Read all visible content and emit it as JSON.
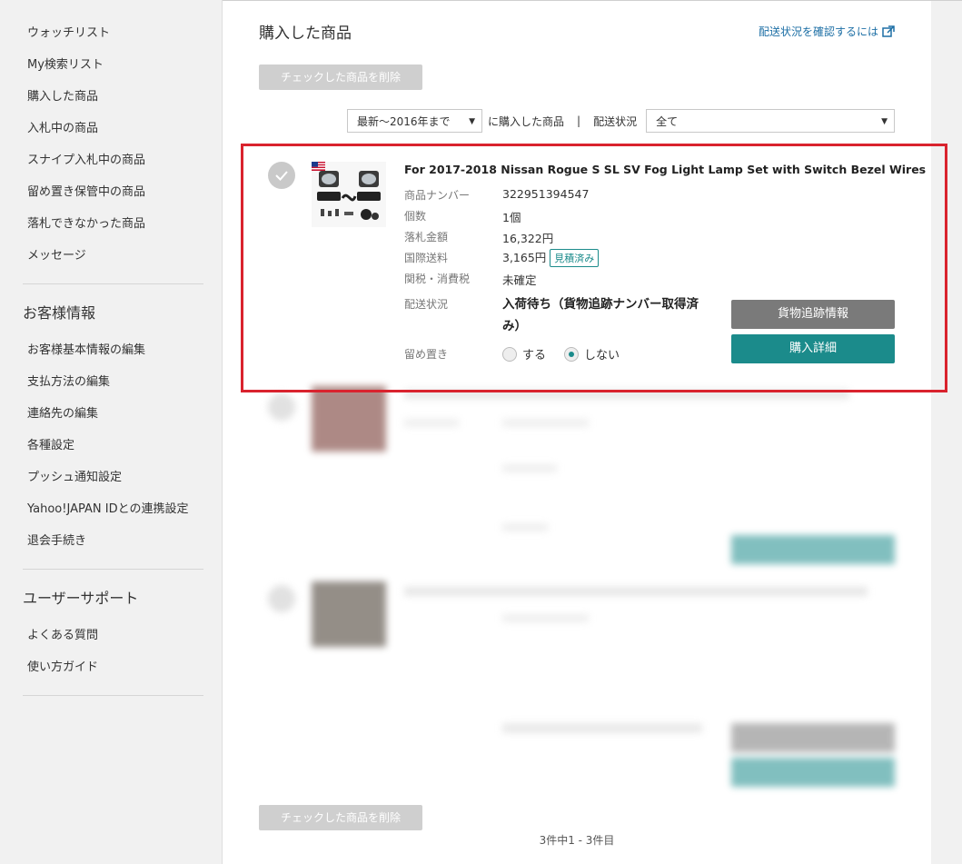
{
  "sidebar": {
    "menu1": [
      "ウォッチリスト",
      "My検索リスト",
      "購入した商品",
      "入札中の商品",
      "スナイプ入札中の商品",
      "留め置き保管中の商品",
      "落札できなかった商品",
      "メッセージ"
    ],
    "section2_title": "お客様情報",
    "menu2": [
      "お客様基本情報の編集",
      "支払方法の編集",
      "連絡先の編集",
      "各種設定",
      "プッシュ通知設定",
      "Yahoo!JAPAN IDとの連携設定",
      "退会手続き"
    ],
    "section3_title": "ユーザーサポート",
    "menu3": [
      "よくある質問",
      "使い方ガイド"
    ]
  },
  "main": {
    "page_title": "購入した商品",
    "help_link": "配送状況を確認するには",
    "delete_checked_label": "チェックした商品を削除",
    "filter": {
      "period_value": "最新～2016年まで",
      "period_suffix": "に購入した商品",
      "separator": "|",
      "status_label": "配送状況",
      "status_value": "全て"
    },
    "items": [
      {
        "title": "For 2017-2018 Nissan Rogue S SL SV Fog Light Lamp Set with Switch Bezel Wires",
        "item_number_label": "商品ナンバー",
        "item_number": "322951394547",
        "quantity_label": "個数",
        "quantity": "1個",
        "price_label": "落札金額",
        "price": "16,322円",
        "shipping_label": "国際送料",
        "shipping": "3,165円",
        "shipping_badge": "見積済み",
        "tax_label": "関税・消費税",
        "tax": "未確定",
        "status_label": "配送状況",
        "status": "入荷待ち（貨物追跡ナンバー取得済み）",
        "hold_label": "留め置き",
        "hold_options": [
          "する",
          "しない"
        ],
        "hold_selected": "しない",
        "tracking_button": "貨物追跡情報",
        "detail_button": "購入詳細"
      }
    ],
    "pagination": "3件中1 - 3件目"
  },
  "colors": {
    "accent": "#1b8b8b",
    "highlight": "#d9232e",
    "link": "#1d6fa5"
  }
}
